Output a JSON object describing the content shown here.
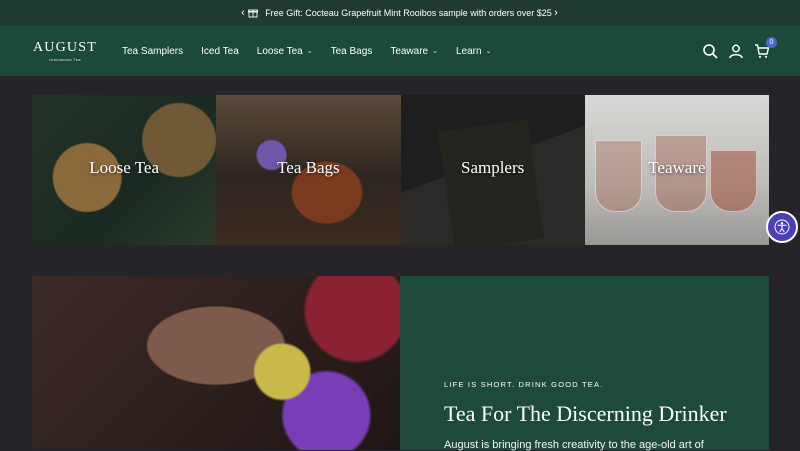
{
  "announcement": {
    "text": "Free Gift: Cocteau Grapefruit Mint Rooibos sample with orders over $25",
    "prev": "‹",
    "next": "›"
  },
  "header": {
    "logo": {
      "word": "AUGUST",
      "sub": "Uncommon Tea"
    },
    "nav": [
      {
        "label": "Tea Samplers",
        "chevron": ""
      },
      {
        "label": "Iced Tea",
        "chevron": ""
      },
      {
        "label": "Loose Tea",
        "chevron": "⌄"
      },
      {
        "label": "Tea Bags",
        "chevron": ""
      },
      {
        "label": "Teaware",
        "chevron": "⌄"
      },
      {
        "label": "Learn",
        "chevron": "⌄"
      }
    ],
    "cart_count": "0"
  },
  "categories": [
    {
      "label": "Loose Tea"
    },
    {
      "label": "Tea Bags"
    },
    {
      "label": "Samplers"
    },
    {
      "label": "Teaware"
    }
  ],
  "hero": {
    "eyebrow": "LIFE IS SHORT. DRINK GOOD TEA.",
    "title": "Tea For The Discerning Drinker",
    "body": "August is bringing fresh creativity to the age-old art of"
  },
  "colors": {
    "announce_bg": "#1f3b30",
    "header_bg": "#1b4a3a",
    "page_bg": "#262428",
    "accessibility": "#4a3fb8"
  }
}
